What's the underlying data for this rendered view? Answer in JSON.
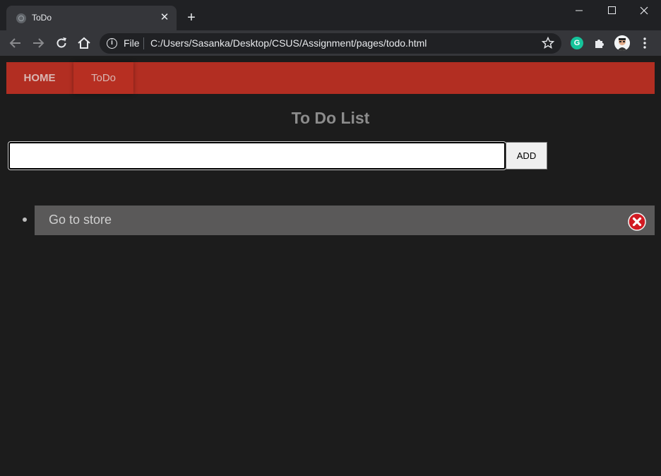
{
  "browser": {
    "tab_title": "ToDo",
    "tab_close": "✕",
    "new_tab": "+",
    "address_scheme_label": "File",
    "address_url": "C:/Users/Sasanka/Desktop/CSUS/Assignment/pages/todo.html",
    "grammarly_letter": "G"
  },
  "nav": {
    "home_label": "HOME",
    "todo_label": "ToDo"
  },
  "main": {
    "title": "To Do List",
    "input_value": "",
    "add_label": "ADD",
    "items": [
      {
        "text": "Go to store"
      }
    ]
  },
  "colors": {
    "nav_bg": "#b22e22",
    "item_bg": "#5a5959",
    "delete_red": "#d11a22"
  }
}
